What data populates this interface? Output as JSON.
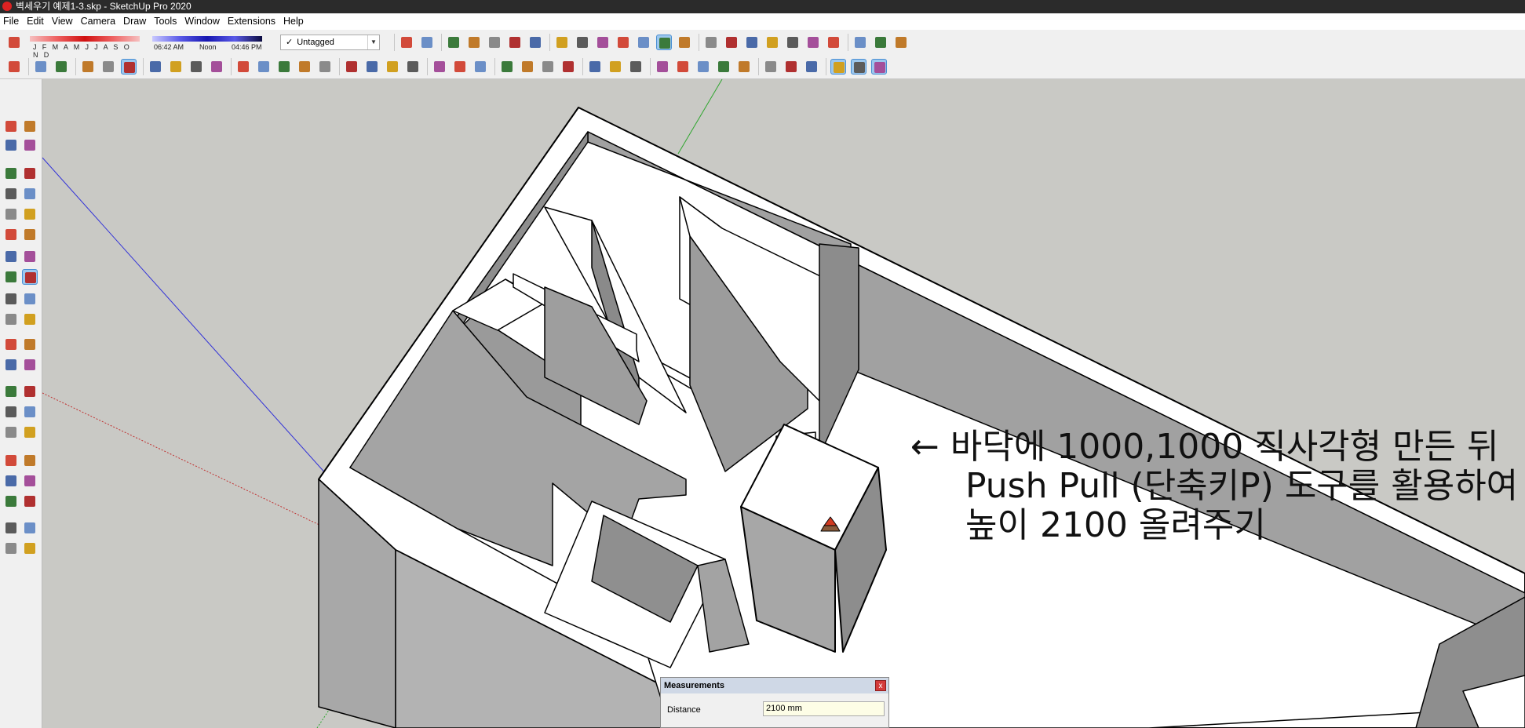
{
  "window": {
    "title": "벽세우기 예제1-3.skp - SketchUp Pro 2020"
  },
  "menu": [
    "File",
    "Edit",
    "View",
    "Camera",
    "Draw",
    "Tools",
    "Window",
    "Extensions",
    "Help"
  ],
  "shadows": {
    "months": "J F M A M J J A S O N D",
    "time_start": "06:42 AM",
    "time_mid": "Noon",
    "time_end": "04:46 PM"
  },
  "tag": {
    "check": "✓",
    "value": "Untagged"
  },
  "annotation": {
    "arrow": "←",
    "line1": "바닥에 1000,1000 직사각형 만든 뒤",
    "line2": "Push Pull (단축키P) 도구를 활용하여",
    "line3": "높이 2100 올려주기"
  },
  "measurements": {
    "title": "Measurements",
    "close": "x",
    "label": "Distance",
    "value": "2100 mm"
  },
  "colors": {
    "viewport_bg": "#c9c9c5",
    "wall_top": "#ffffff",
    "wall_side": "#a8a8a8",
    "wall_dark": "#8e8e8e",
    "floor": "#ffffff",
    "axis_green": "#2fa62f",
    "axis_blue": "#3030d8",
    "axis_red": "#c03030"
  },
  "toolbar": {
    "row1": [
      "eraser-tool-icon",
      "shadow-months-slider",
      "shadow-time-slider",
      "tag-dropdown",
      "iso-view-icon",
      "top-view-icon",
      "front-view-icon",
      "right-view-icon",
      "back-view-icon",
      "left-view-icon",
      "bottom-view-icon",
      "xray-icon",
      "back-edges-icon",
      "wireframe-icon",
      "hidden-line-icon",
      "shaded-icon",
      "shaded-textures-icon",
      "monochrome-icon",
      "orbit-icon",
      "pan-icon",
      "zoom-icon",
      "zoom-window-icon",
      "zoom-extents-icon",
      "previous-view-icon",
      "position-camera-icon",
      "look-around-icon",
      "walk-icon",
      "extension-warehouse-icon"
    ],
    "row2": [
      "select-icon",
      "eraser-icon",
      "pencil-icon",
      "arc-icon",
      "rectangle-icon",
      "push-pull-icon",
      "follow-me-icon",
      "move-icon",
      "rotate-icon",
      "scale-icon",
      "tape-measure-icon",
      "text-icon",
      "paint-bucket-icon",
      "orbit-icon",
      "pan-icon",
      "zoom-icon",
      "zoom-extents-icon",
      "3d-warehouse-icon",
      "share-model-icon",
      "extension-icon",
      "sandbox-icon",
      "geo-location-icon",
      "section-plane-icon",
      "house-icon",
      "house-outline-icon",
      "shed-icon",
      "style-icon",
      "group-icon",
      "component-icon",
      "solid-icon",
      "intersect-icon",
      "union-icon",
      "subtract-icon",
      "outer-shell-icon",
      "trim-icon",
      "split-icon",
      "axes-icon",
      "iso-icon",
      "perspective-icon",
      "parallel-icon"
    ]
  }
}
